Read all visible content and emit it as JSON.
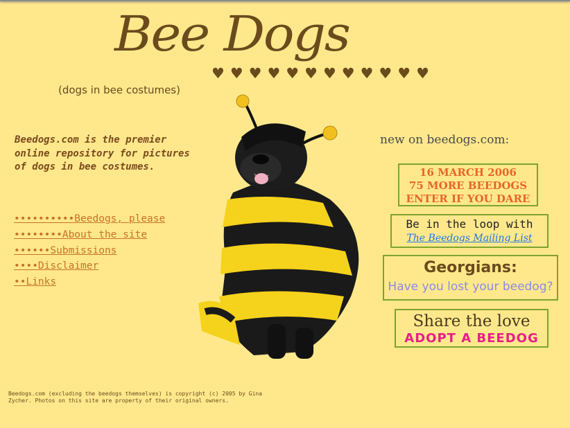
{
  "header": {
    "logo": "Bee Dogs",
    "hearts": "♥♥♥♥♥♥♥♥♥♥♥♥",
    "tagline": "(dogs in bee costumes)"
  },
  "intro": "Beedogs.com is the premier online repository for pictures of dogs in bee costumes.",
  "nav": {
    "items": [
      {
        "label": "••••••••••Beedogs, please"
      },
      {
        "label": "••••••••About the site"
      },
      {
        "label": "••••••Submissions"
      },
      {
        "label": "••••Disclaimer"
      },
      {
        "label": "••Links"
      }
    ]
  },
  "new_on": {
    "label": "new on beedogs.com:"
  },
  "promos": {
    "march": {
      "line1": "16 MARCH 2006",
      "line2": "75 MORE BEEDOGS",
      "line3": "ENTER IF YOU DARE"
    },
    "mailing": {
      "line1": "Be in the loop with",
      "line2": "The Beedogs Mailing List"
    },
    "georgians": {
      "line1": "Georgians:",
      "line2": "Have you lost your beedog?"
    },
    "adopt": {
      "line1": "Share the love",
      "line2": "ADOPT A BEEDOG"
    }
  },
  "footer": {
    "copyright": "Beedogs.com (excluding the beedogs themselves) is copyright (c) 2005 by Gina Zycher.  Photos on this site are property of their original owners."
  },
  "colors": {
    "background": "#ffe88c",
    "brown": "#6b4a1c",
    "link": "#c8722a",
    "box_border": "#7ea22e"
  }
}
